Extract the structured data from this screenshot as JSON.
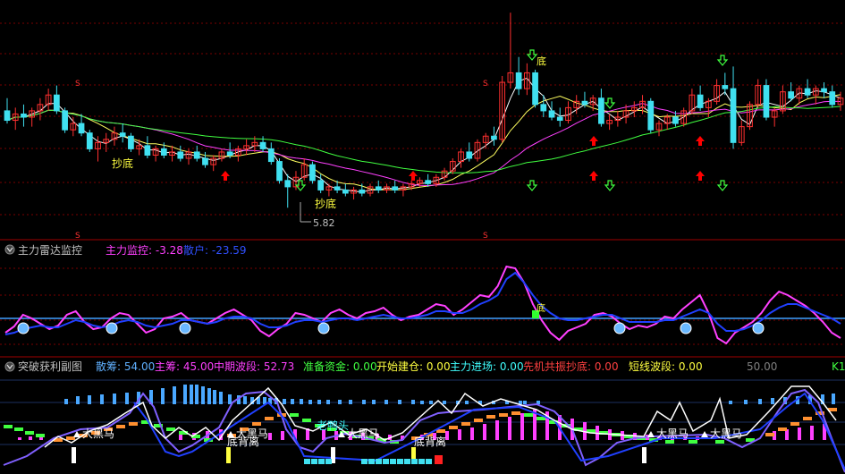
{
  "colors": {
    "background": "#000000",
    "grid": "#7a0000",
    "separator": "#a00000",
    "up_candle": "#ff3030",
    "down_candle": "#40e0f0",
    "ma_white": "#ffffff",
    "ma_yellow": "#ffff60",
    "ma_magenta": "#ff40ff",
    "ma_green": "#40ff40",
    "label_yellow": "#ffff40",
    "arrow_red": "#ff0000",
    "arrow_green": "#40ff40",
    "baseline_cyan": "#40a0ff",
    "panel2_magenta": "#ff40ff",
    "panel2_blue": "#2040ff",
    "panel3_header_blue": "#60b0ff",
    "panel3_header_magenta": "#ff40ff",
    "panel3_header_green": "#40ff40",
    "panel3_header_yellow": "#ffff40",
    "panel3_header_cyan": "#40ffff",
    "panel3_header_red": "#ff4040",
    "panel3_header_gray": "#808080"
  },
  "main": {
    "labels": {
      "chaodi_1": "抄底",
      "chaodi_2": "抄底",
      "di": "底",
      "low_price": "5.82",
      "s_marker": "S"
    }
  },
  "panel2": {
    "title": "主力雷达监控",
    "line1_label": "主力监控: -3.28",
    "line2_label": "散户: -23.59",
    "di_label": "底"
  },
  "panel3": {
    "title": "突破获利副图",
    "items": [
      {
        "text": "散筹: 54.00",
        "color": "#60b0ff"
      },
      {
        "text": "主筹: 45.00",
        "color": "#ff40ff"
      },
      {
        "text": "中期波段: 52.73",
        "color": "#ff40ff"
      },
      {
        "text": "准备资金: 0.00",
        "color": "#40ff40"
      },
      {
        "text": "开始建仓: 0.00",
        "color": "#ffff40"
      },
      {
        "text": "主力进场: 0.00",
        "color": "#40ffff"
      },
      {
        "text": "先机共振抄底: 0.00",
        "color": "#ff4040"
      },
      {
        "text": "短线波段: 0.00",
        "color": "#ffff40"
      }
    ],
    "scale_label": "50.00",
    "corner_label": "K1",
    "dahema_label": "大黑马",
    "dibeili_label": "底背离",
    "laoyaotou_label": "老鸭头"
  },
  "chart_data": [
    {
      "type": "candlestick",
      "title": "",
      "low_marker": 5.82,
      "candles": [
        {
          "o": 7.35,
          "h": 7.55,
          "l": 7.15,
          "c": 7.2
        },
        {
          "o": 7.2,
          "h": 7.4,
          "l": 7.05,
          "c": 7.3
        },
        {
          "o": 7.3,
          "h": 7.45,
          "l": 7.1,
          "c": 7.25
        },
        {
          "o": 7.25,
          "h": 7.4,
          "l": 7.1,
          "c": 7.35
        },
        {
          "o": 7.35,
          "h": 7.55,
          "l": 7.2,
          "c": 7.45
        },
        {
          "o": 7.45,
          "h": 7.7,
          "l": 7.35,
          "c": 7.6
        },
        {
          "o": 7.6,
          "h": 7.75,
          "l": 7.3,
          "c": 7.35
        },
        {
          "o": 7.35,
          "h": 7.4,
          "l": 7.0,
          "c": 7.05
        },
        {
          "o": 7.05,
          "h": 7.25,
          "l": 6.95,
          "c": 7.15
        },
        {
          "o": 7.15,
          "h": 7.3,
          "l": 6.95,
          "c": 7.0
        },
        {
          "o": 7.0,
          "h": 7.05,
          "l": 6.7,
          "c": 6.75
        },
        {
          "o": 6.75,
          "h": 6.95,
          "l": 6.55,
          "c": 6.85
        },
        {
          "o": 6.85,
          "h": 7.0,
          "l": 6.7,
          "c": 6.9
        },
        {
          "o": 6.9,
          "h": 7.1,
          "l": 6.8,
          "c": 7.0
        },
        {
          "o": 7.0,
          "h": 7.15,
          "l": 6.85,
          "c": 6.95
        },
        {
          "o": 6.95,
          "h": 7.0,
          "l": 6.7,
          "c": 6.75
        },
        {
          "o": 6.75,
          "h": 6.9,
          "l": 6.65,
          "c": 6.8
        },
        {
          "o": 6.8,
          "h": 6.95,
          "l": 6.6,
          "c": 6.65
        },
        {
          "o": 6.65,
          "h": 6.8,
          "l": 6.55,
          "c": 6.75
        },
        {
          "o": 6.75,
          "h": 6.85,
          "l": 6.6,
          "c": 6.65
        },
        {
          "o": 6.65,
          "h": 6.8,
          "l": 6.55,
          "c": 6.7
        },
        {
          "o": 6.7,
          "h": 6.8,
          "l": 6.55,
          "c": 6.6
        },
        {
          "o": 6.6,
          "h": 6.75,
          "l": 6.5,
          "c": 6.7
        },
        {
          "o": 6.7,
          "h": 6.8,
          "l": 6.55,
          "c": 6.6
        },
        {
          "o": 6.6,
          "h": 6.7,
          "l": 6.45,
          "c": 6.5
        },
        {
          "o": 6.5,
          "h": 6.65,
          "l": 6.4,
          "c": 6.6
        },
        {
          "o": 6.6,
          "h": 6.75,
          "l": 6.55,
          "c": 6.7
        },
        {
          "o": 6.7,
          "h": 6.85,
          "l": 6.6,
          "c": 6.65
        },
        {
          "o": 6.65,
          "h": 6.8,
          "l": 6.55,
          "c": 6.75
        },
        {
          "o": 6.75,
          "h": 6.9,
          "l": 6.65,
          "c": 6.8
        },
        {
          "o": 6.8,
          "h": 6.95,
          "l": 6.7,
          "c": 6.85
        },
        {
          "o": 6.85,
          "h": 6.95,
          "l": 6.7,
          "c": 6.75
        },
        {
          "o": 6.75,
          "h": 6.85,
          "l": 6.5,
          "c": 6.55
        },
        {
          "o": 6.55,
          "h": 6.6,
          "l": 6.2,
          "c": 6.25
        },
        {
          "o": 6.25,
          "h": 6.35,
          "l": 5.82,
          "c": 6.15
        },
        {
          "o": 6.15,
          "h": 6.4,
          "l": 6.1,
          "c": 6.3
        },
        {
          "o": 6.3,
          "h": 6.6,
          "l": 6.25,
          "c": 6.5
        },
        {
          "o": 6.5,
          "h": 6.55,
          "l": 6.2,
          "c": 6.25
        },
        {
          "o": 6.25,
          "h": 6.35,
          "l": 6.05,
          "c": 6.1
        },
        {
          "o": 6.1,
          "h": 6.2,
          "l": 6.0,
          "c": 6.15
        },
        {
          "o": 6.15,
          "h": 6.25,
          "l": 6.05,
          "c": 6.1
        },
        {
          "o": 6.1,
          "h": 6.2,
          "l": 6.0,
          "c": 6.05
        },
        {
          "o": 6.05,
          "h": 6.15,
          "l": 5.95,
          "c": 6.1
        },
        {
          "o": 6.1,
          "h": 6.2,
          "l": 6.0,
          "c": 6.05
        },
        {
          "o": 6.05,
          "h": 6.2,
          "l": 6.0,
          "c": 6.15
        },
        {
          "o": 6.15,
          "h": 6.25,
          "l": 6.05,
          "c": 6.1
        },
        {
          "o": 6.1,
          "h": 6.2,
          "l": 6.05,
          "c": 6.15
        },
        {
          "o": 6.15,
          "h": 6.25,
          "l": 6.05,
          "c": 6.1
        },
        {
          "o": 6.1,
          "h": 6.2,
          "l": 6.0,
          "c": 6.15
        },
        {
          "o": 6.15,
          "h": 6.25,
          "l": 6.1,
          "c": 6.2
        },
        {
          "o": 6.2,
          "h": 6.3,
          "l": 6.15,
          "c": 6.25
        },
        {
          "o": 6.25,
          "h": 6.35,
          "l": 6.15,
          "c": 6.2
        },
        {
          "o": 6.2,
          "h": 6.35,
          "l": 6.15,
          "c": 6.3
        },
        {
          "o": 6.3,
          "h": 6.45,
          "l": 6.25,
          "c": 6.4
        },
        {
          "o": 6.4,
          "h": 6.6,
          "l": 6.35,
          "c": 6.55
        },
        {
          "o": 6.55,
          "h": 6.75,
          "l": 6.45,
          "c": 6.7
        },
        {
          "o": 6.7,
          "h": 6.85,
          "l": 6.55,
          "c": 6.6
        },
        {
          "o": 6.6,
          "h": 6.9,
          "l": 6.55,
          "c": 6.85
        },
        {
          "o": 6.85,
          "h": 7.0,
          "l": 6.75,
          "c": 6.95
        },
        {
          "o": 6.95,
          "h": 7.1,
          "l": 6.8,
          "c": 6.9
        },
        {
          "o": 6.9,
          "h": 7.9,
          "l": 6.85,
          "c": 7.8
        },
        {
          "o": 7.8,
          "h": 8.9,
          "l": 7.7,
          "c": 7.95
        },
        {
          "o": 7.95,
          "h": 8.2,
          "l": 7.6,
          "c": 7.7
        },
        {
          "o": 7.7,
          "h": 8.1,
          "l": 7.6,
          "c": 7.95
        },
        {
          "o": 7.95,
          "h": 8.0,
          "l": 7.4,
          "c": 7.45
        },
        {
          "o": 7.45,
          "h": 7.6,
          "l": 7.25,
          "c": 7.35
        },
        {
          "o": 7.35,
          "h": 7.5,
          "l": 7.2,
          "c": 7.25
        },
        {
          "o": 7.25,
          "h": 7.4,
          "l": 7.1,
          "c": 7.2
        },
        {
          "o": 7.2,
          "h": 7.5,
          "l": 7.15,
          "c": 7.4
        },
        {
          "o": 7.4,
          "h": 7.6,
          "l": 7.3,
          "c": 7.5
        },
        {
          "o": 7.5,
          "h": 7.65,
          "l": 7.4,
          "c": 7.45
        },
        {
          "o": 7.45,
          "h": 7.6,
          "l": 7.35,
          "c": 7.55
        },
        {
          "o": 7.55,
          "h": 7.7,
          "l": 7.1,
          "c": 7.15
        },
        {
          "o": 7.15,
          "h": 7.3,
          "l": 7.05,
          "c": 7.2
        },
        {
          "o": 7.2,
          "h": 7.35,
          "l": 7.1,
          "c": 7.25
        },
        {
          "o": 7.25,
          "h": 7.45,
          "l": 7.15,
          "c": 7.35
        },
        {
          "o": 7.35,
          "h": 7.5,
          "l": 7.25,
          "c": 7.4
        },
        {
          "o": 7.4,
          "h": 7.6,
          "l": 7.3,
          "c": 7.5
        },
        {
          "o": 7.5,
          "h": 7.55,
          "l": 7.0,
          "c": 7.05
        },
        {
          "o": 7.05,
          "h": 7.2,
          "l": 6.95,
          "c": 7.15
        },
        {
          "o": 7.15,
          "h": 7.3,
          "l": 7.05,
          "c": 7.25
        },
        {
          "o": 7.25,
          "h": 7.35,
          "l": 7.1,
          "c": 7.15
        },
        {
          "o": 7.15,
          "h": 7.4,
          "l": 7.1,
          "c": 7.35
        },
        {
          "o": 7.35,
          "h": 7.7,
          "l": 7.3,
          "c": 7.6
        },
        {
          "o": 7.6,
          "h": 7.75,
          "l": 7.35,
          "c": 7.4
        },
        {
          "o": 7.4,
          "h": 7.55,
          "l": 7.25,
          "c": 7.5
        },
        {
          "o": 7.5,
          "h": 7.85,
          "l": 7.45,
          "c": 7.75
        },
        {
          "o": 7.75,
          "h": 7.95,
          "l": 7.6,
          "c": 7.7
        },
        {
          "o": 7.7,
          "h": 8.05,
          "l": 6.75,
          "c": 6.85
        },
        {
          "o": 6.85,
          "h": 7.2,
          "l": 6.8,
          "c": 7.1
        },
        {
          "o": 7.1,
          "h": 7.5,
          "l": 7.05,
          "c": 7.45
        },
        {
          "o": 7.45,
          "h": 7.85,
          "l": 7.4,
          "c": 7.75
        },
        {
          "o": 7.75,
          "h": 7.85,
          "l": 7.2,
          "c": 7.25
        },
        {
          "o": 7.25,
          "h": 7.4,
          "l": 7.1,
          "c": 7.35
        },
        {
          "o": 7.35,
          "h": 7.75,
          "l": 7.3,
          "c": 7.65
        },
        {
          "o": 7.65,
          "h": 7.8,
          "l": 7.5,
          "c": 7.55
        },
        {
          "o": 7.55,
          "h": 7.75,
          "l": 7.45,
          "c": 7.7
        },
        {
          "o": 7.7,
          "h": 7.85,
          "l": 7.55,
          "c": 7.6
        },
        {
          "o": 7.6,
          "h": 7.75,
          "l": 7.45,
          "c": 7.7
        },
        {
          "o": 7.7,
          "h": 7.8,
          "l": 7.55,
          "c": 7.65
        },
        {
          "o": 7.65,
          "h": 7.75,
          "l": 7.4,
          "c": 7.45
        },
        {
          "o": 7.45,
          "h": 7.65,
          "l": 7.35,
          "c": 7.55
        }
      ]
    },
    {
      "type": "line",
      "title": "主力雷达监控",
      "series": [
        {
          "name": "主力监控",
          "last": -3.28
        },
        {
          "name": "散户",
          "last": -23.59
        }
      ]
    },
    {
      "type": "bar",
      "title": "突破获利副图",
      "series": [
        {
          "name": "散筹",
          "last": 54.0
        },
        {
          "name": "主筹",
          "last": 45.0
        },
        {
          "name": "中期波段",
          "last": 52.73
        },
        {
          "name": "准备资金",
          "last": 0.0
        },
        {
          "name": "开始建仓",
          "last": 0.0
        },
        {
          "name": "主力进场",
          "last": 0.0
        },
        {
          "name": "先机共振抄底",
          "last": 0.0
        },
        {
          "name": "短线波段",
          "last": 0.0
        }
      ]
    }
  ]
}
